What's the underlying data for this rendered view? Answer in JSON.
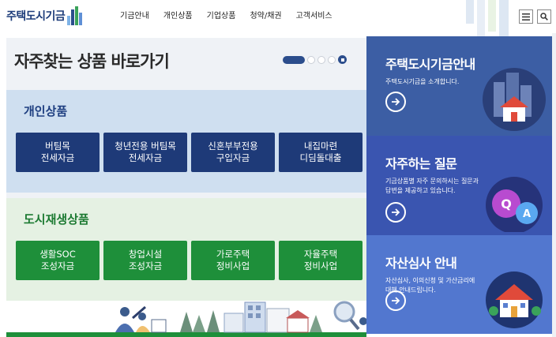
{
  "header": {
    "logo_text": "주택도시기금",
    "nav": [
      "기금안내",
      "개인상품",
      "기업상품",
      "청약/채권",
      "고객서비스"
    ]
  },
  "quick": {
    "title": "자주찾는 상품 바로가기"
  },
  "personal": {
    "title": "개인상품",
    "buttons": [
      {
        "line1": "버팀목",
        "line2": "전세자금"
      },
      {
        "line1": "청년전용 버팀목",
        "line2": "전세자금"
      },
      {
        "line1": "신혼부부전용",
        "line2": "구입자금"
      },
      {
        "line1": "내집마련",
        "line2": "디딤돌대출"
      }
    ]
  },
  "city": {
    "title": "도시재생상품",
    "buttons": [
      {
        "line1": "생활SOC",
        "line2": "조성자금"
      },
      {
        "line1": "창업시설",
        "line2": "조성자금"
      },
      {
        "line1": "가로주택",
        "line2": "정비사업"
      },
      {
        "line1": "자율주택",
        "line2": "정비사업"
      }
    ]
  },
  "cards": [
    {
      "title": "주택도시기금안내",
      "desc": "주택도시기금을 소개합니다."
    },
    {
      "title": "자주하는 질문",
      "desc": "기금상품별 자주 문의하시는 질문과 답변을 제공하고 있습니다."
    },
    {
      "title": "자산심사 안내",
      "desc": "자산심사, 이의신청 및 가산금리에 대해 안내드립니다."
    }
  ],
  "faq_bubbles": {
    "q": "Q",
    "a": "A"
  },
  "colors": {
    "navy": "#1e3a78",
    "green": "#1e8f3a",
    "card_1": "#3c5ea4",
    "card_2": "#3a55b0",
    "card_3": "#5277cf"
  },
  "icons": [
    "menu-icon",
    "search-icon",
    "pause-icon",
    "arrow-right-icon"
  ]
}
